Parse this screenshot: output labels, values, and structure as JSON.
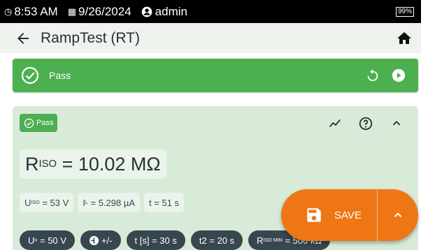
{
  "status": {
    "time": "8:53 AM",
    "date": "9/26/2024",
    "user": "admin",
    "battery": "99%"
  },
  "appbar": {
    "title": "RampTest (RT)",
    "back_icon": "arrow-left-icon",
    "home_icon": "home-icon"
  },
  "banner": {
    "label": "Pass",
    "color": "#4caf50"
  },
  "card": {
    "chip": "Pass",
    "result": {
      "symbol": "R",
      "sub": "ISO",
      "value": "= 10.02 MΩ"
    },
    "readings": [
      {
        "symbol": "U",
        "sub": "ISO",
        "value": "= 53 V"
      },
      {
        "symbol": "I",
        "sub": "L",
        "value": "= 5.298 µA"
      },
      {
        "symbol": "t",
        "sub": "",
        "value": "= 51 s"
      }
    ],
    "params": [
      {
        "symbol": "U",
        "sub": "n",
        "value": "= 50 V"
      },
      {
        "label": "+/-"
      },
      {
        "label": "t [s] = 30 s"
      },
      {
        "label": "t2  = 20 s"
      },
      {
        "symbol": "R",
        "sub": "ISO MIN",
        "value": "= 500 kΩ"
      }
    ]
  },
  "fab": {
    "save_label": "SAVE",
    "color": "#ef7614"
  }
}
